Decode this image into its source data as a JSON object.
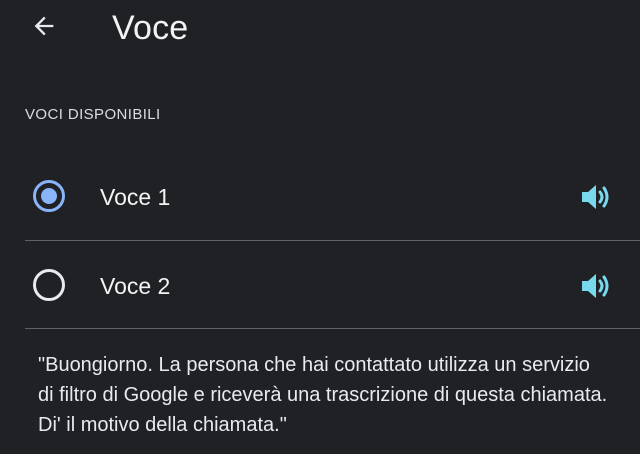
{
  "header": {
    "back_icon": "arrow-back-icon",
    "title": "Voce"
  },
  "section": {
    "title": "VOCI DISPONIBILI"
  },
  "voices": [
    {
      "label": "Voce 1",
      "selected": true,
      "play_icon": "speaker-icon"
    },
    {
      "label": "Voce 2",
      "selected": false,
      "play_icon": "speaker-icon"
    }
  ],
  "preview": {
    "text": "\"Buongiorno. La persona che hai contattato utilizza un servizio di filtro di Google e riceverà una trascrizione di questa chiamata. Di' il motivo della chiamata.\""
  },
  "colors": {
    "background": "#1f2125",
    "accent": "#8ab4f8",
    "speaker": "#78d9ec",
    "divider": "#5f6368",
    "text": "#e8eaed"
  }
}
